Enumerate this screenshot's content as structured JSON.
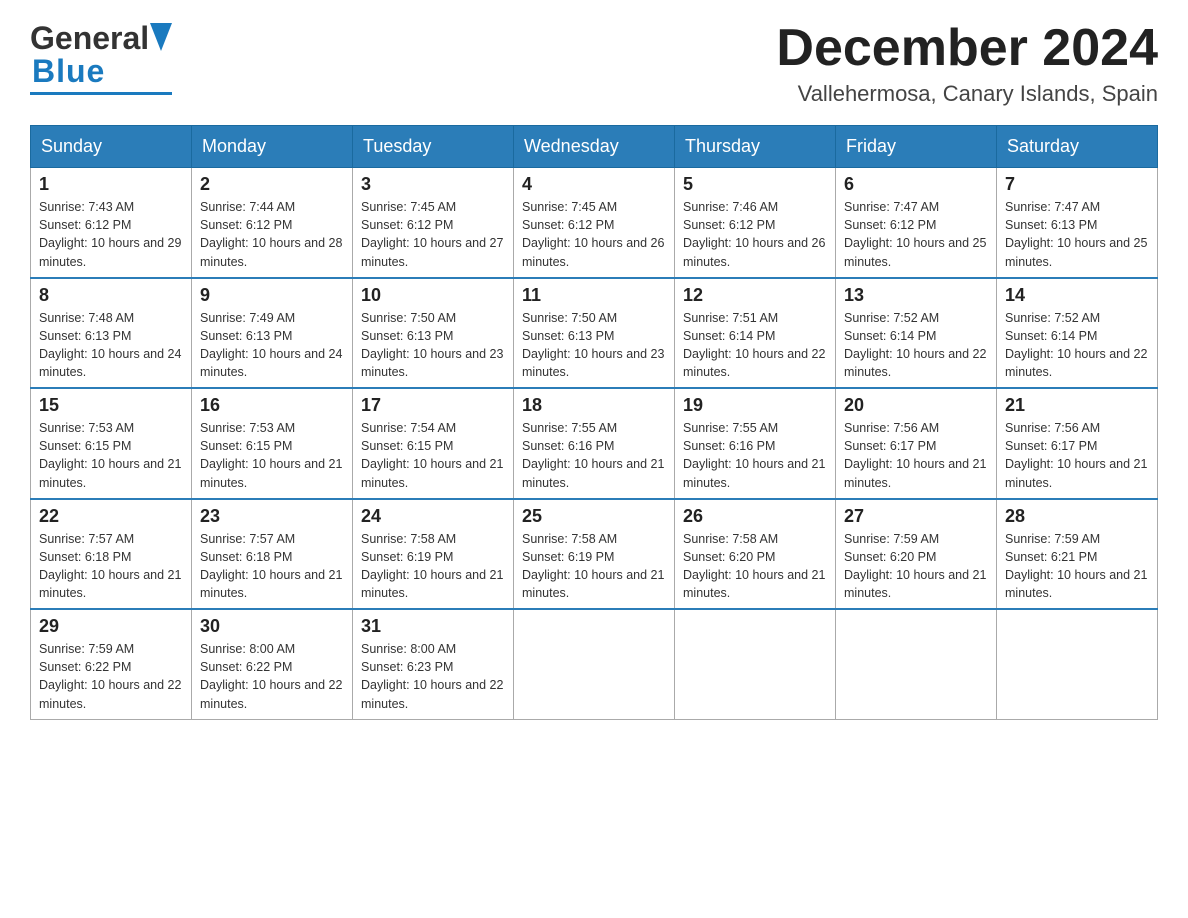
{
  "header": {
    "logo_general": "General",
    "logo_blue": "Blue",
    "month_title": "December 2024",
    "location": "Vallehermosa, Canary Islands, Spain"
  },
  "days_of_week": [
    "Sunday",
    "Monday",
    "Tuesday",
    "Wednesday",
    "Thursday",
    "Friday",
    "Saturday"
  ],
  "weeks": [
    [
      {
        "day": "1",
        "sunrise": "7:43 AM",
        "sunset": "6:12 PM",
        "daylight": "10 hours and 29 minutes."
      },
      {
        "day": "2",
        "sunrise": "7:44 AM",
        "sunset": "6:12 PM",
        "daylight": "10 hours and 28 minutes."
      },
      {
        "day": "3",
        "sunrise": "7:45 AM",
        "sunset": "6:12 PM",
        "daylight": "10 hours and 27 minutes."
      },
      {
        "day": "4",
        "sunrise": "7:45 AM",
        "sunset": "6:12 PM",
        "daylight": "10 hours and 26 minutes."
      },
      {
        "day": "5",
        "sunrise": "7:46 AM",
        "sunset": "6:12 PM",
        "daylight": "10 hours and 26 minutes."
      },
      {
        "day": "6",
        "sunrise": "7:47 AM",
        "sunset": "6:12 PM",
        "daylight": "10 hours and 25 minutes."
      },
      {
        "day": "7",
        "sunrise": "7:47 AM",
        "sunset": "6:13 PM",
        "daylight": "10 hours and 25 minutes."
      }
    ],
    [
      {
        "day": "8",
        "sunrise": "7:48 AM",
        "sunset": "6:13 PM",
        "daylight": "10 hours and 24 minutes."
      },
      {
        "day": "9",
        "sunrise": "7:49 AM",
        "sunset": "6:13 PM",
        "daylight": "10 hours and 24 minutes."
      },
      {
        "day": "10",
        "sunrise": "7:50 AM",
        "sunset": "6:13 PM",
        "daylight": "10 hours and 23 minutes."
      },
      {
        "day": "11",
        "sunrise": "7:50 AM",
        "sunset": "6:13 PM",
        "daylight": "10 hours and 23 minutes."
      },
      {
        "day": "12",
        "sunrise": "7:51 AM",
        "sunset": "6:14 PM",
        "daylight": "10 hours and 22 minutes."
      },
      {
        "day": "13",
        "sunrise": "7:52 AM",
        "sunset": "6:14 PM",
        "daylight": "10 hours and 22 minutes."
      },
      {
        "day": "14",
        "sunrise": "7:52 AM",
        "sunset": "6:14 PM",
        "daylight": "10 hours and 22 minutes."
      }
    ],
    [
      {
        "day": "15",
        "sunrise": "7:53 AM",
        "sunset": "6:15 PM",
        "daylight": "10 hours and 21 minutes."
      },
      {
        "day": "16",
        "sunrise": "7:53 AM",
        "sunset": "6:15 PM",
        "daylight": "10 hours and 21 minutes."
      },
      {
        "day": "17",
        "sunrise": "7:54 AM",
        "sunset": "6:15 PM",
        "daylight": "10 hours and 21 minutes."
      },
      {
        "day": "18",
        "sunrise": "7:55 AM",
        "sunset": "6:16 PM",
        "daylight": "10 hours and 21 minutes."
      },
      {
        "day": "19",
        "sunrise": "7:55 AM",
        "sunset": "6:16 PM",
        "daylight": "10 hours and 21 minutes."
      },
      {
        "day": "20",
        "sunrise": "7:56 AM",
        "sunset": "6:17 PM",
        "daylight": "10 hours and 21 minutes."
      },
      {
        "day": "21",
        "sunrise": "7:56 AM",
        "sunset": "6:17 PM",
        "daylight": "10 hours and 21 minutes."
      }
    ],
    [
      {
        "day": "22",
        "sunrise": "7:57 AM",
        "sunset": "6:18 PM",
        "daylight": "10 hours and 21 minutes."
      },
      {
        "day": "23",
        "sunrise": "7:57 AM",
        "sunset": "6:18 PM",
        "daylight": "10 hours and 21 minutes."
      },
      {
        "day": "24",
        "sunrise": "7:58 AM",
        "sunset": "6:19 PM",
        "daylight": "10 hours and 21 minutes."
      },
      {
        "day": "25",
        "sunrise": "7:58 AM",
        "sunset": "6:19 PM",
        "daylight": "10 hours and 21 minutes."
      },
      {
        "day": "26",
        "sunrise": "7:58 AM",
        "sunset": "6:20 PM",
        "daylight": "10 hours and 21 minutes."
      },
      {
        "day": "27",
        "sunrise": "7:59 AM",
        "sunset": "6:20 PM",
        "daylight": "10 hours and 21 minutes."
      },
      {
        "day": "28",
        "sunrise": "7:59 AM",
        "sunset": "6:21 PM",
        "daylight": "10 hours and 21 minutes."
      }
    ],
    [
      {
        "day": "29",
        "sunrise": "7:59 AM",
        "sunset": "6:22 PM",
        "daylight": "10 hours and 22 minutes."
      },
      {
        "day": "30",
        "sunrise": "8:00 AM",
        "sunset": "6:22 PM",
        "daylight": "10 hours and 22 minutes."
      },
      {
        "day": "31",
        "sunrise": "8:00 AM",
        "sunset": "6:23 PM",
        "daylight": "10 hours and 22 minutes."
      },
      null,
      null,
      null,
      null
    ]
  ],
  "labels": {
    "sunrise": "Sunrise: ",
    "sunset": "Sunset: ",
    "daylight": "Daylight: "
  }
}
